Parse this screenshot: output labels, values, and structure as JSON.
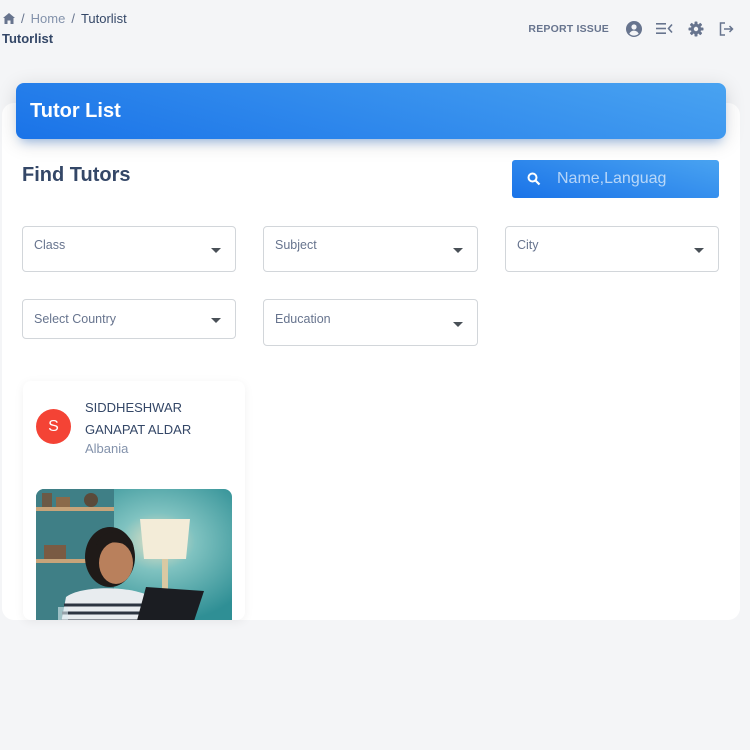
{
  "breadcrumb": {
    "items": [
      "Home",
      "Tutorlist"
    ],
    "separator": "/"
  },
  "page_title": "Tutorlist",
  "top_actions": {
    "report_issue": "REPORT ISSUE",
    "icons": [
      "account-circle-icon",
      "menu-collapse-icon",
      "settings-icon",
      "logout-icon"
    ]
  },
  "banner": {
    "title": "Tutor List"
  },
  "find": {
    "title": "Find Tutors",
    "search_placeholder": "Name,Languag"
  },
  "filters": {
    "class": "Class",
    "subject": "Subject",
    "city": "City",
    "country": "Select Country",
    "education": "Education"
  },
  "tutors": [
    {
      "initial": "S",
      "name": "SIDDHESHWAR GANAPAT ALDAR",
      "country": "Albania"
    }
  ],
  "colors": {
    "accent_blue": "#1A73E8",
    "avatar_red": "#f44335",
    "text_dark": "#344767",
    "text_muted": "#67748e"
  }
}
